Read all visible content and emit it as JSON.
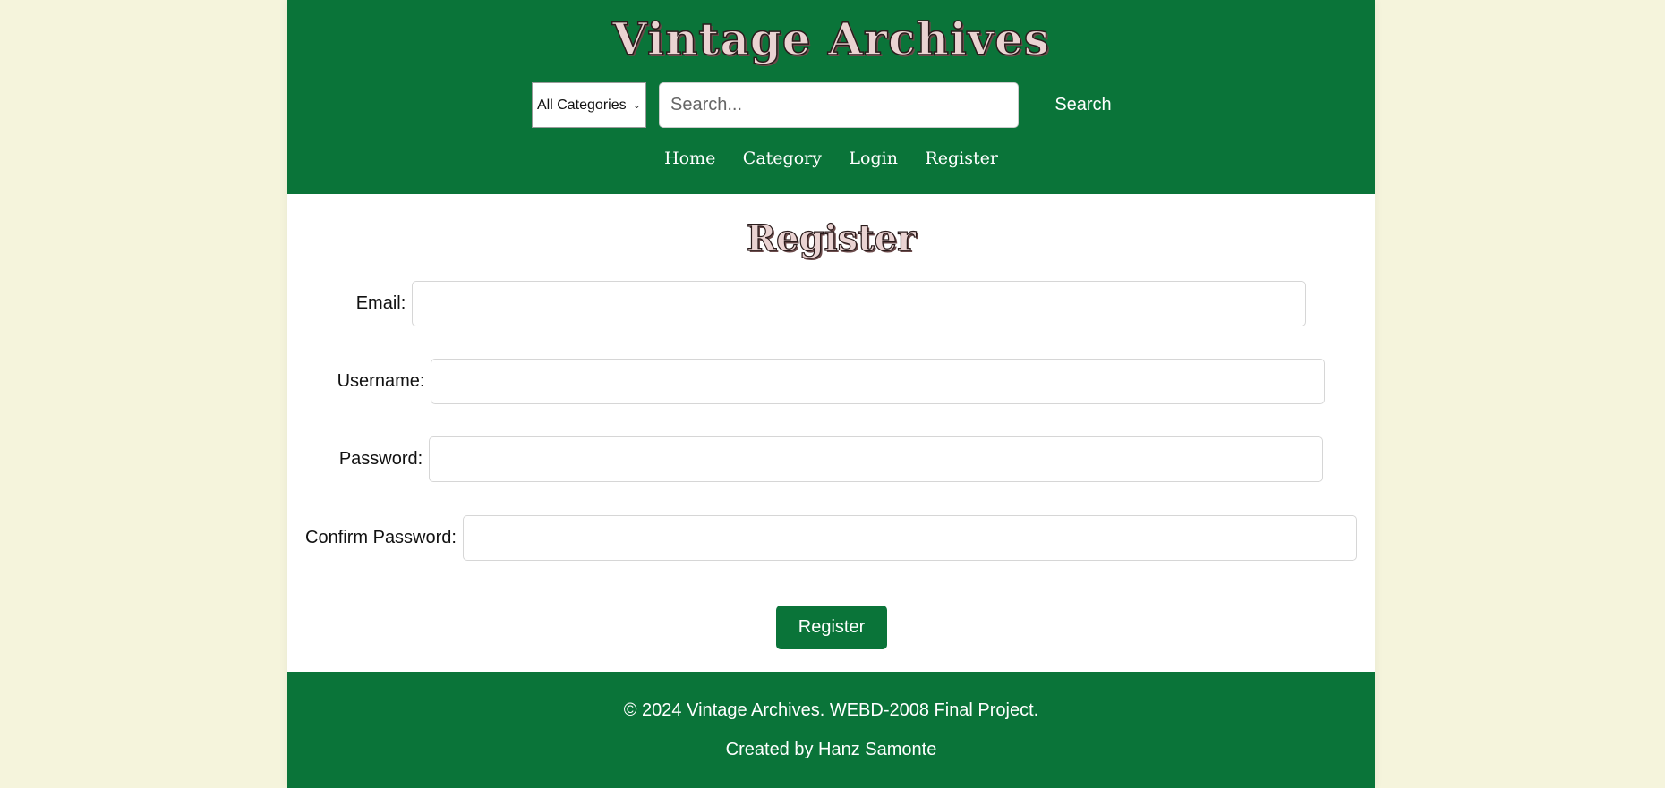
{
  "header": {
    "site_title": "Vintage Archives",
    "search": {
      "category_selected": "All Categories",
      "placeholder": "Search...",
      "value": "",
      "button_label": "Search"
    },
    "nav": [
      "Home",
      "Category",
      "Login",
      "Register"
    ]
  },
  "main": {
    "title": "Register",
    "fields": [
      {
        "label": "Email:",
        "value": ""
      },
      {
        "label": "Username:",
        "value": ""
      },
      {
        "label": "Password:",
        "value": ""
      },
      {
        "label": "Confirm Password:",
        "value": ""
      }
    ],
    "submit_label": "Register"
  },
  "footer": {
    "copyright": "© 2024 Vintage Archives. WEBD-2008 Final Project.",
    "credit": "Created by Hanz Samonte"
  },
  "colors": {
    "page_background": "#f5f4dc",
    "brand_green": "#0a7439",
    "title_fill": "#ead3d2"
  },
  "icons": {
    "select_chevron": "chevron-down-icon"
  }
}
